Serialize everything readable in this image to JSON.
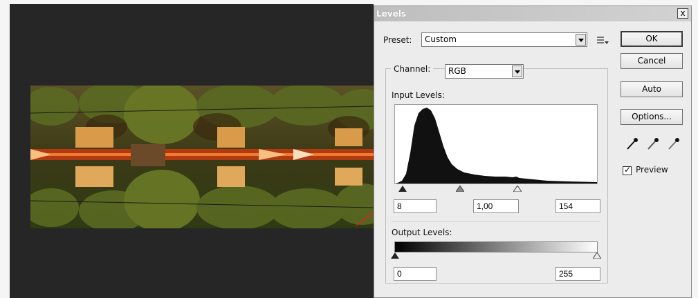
{
  "dialog": {
    "title": "Levels",
    "close": "x"
  },
  "preset": {
    "label": "Preset:",
    "value": "Custom"
  },
  "channel": {
    "label": "Channel:",
    "value": "RGB"
  },
  "input_levels": {
    "label": "Input Levels:",
    "black": "8",
    "gamma": "1,00",
    "white": "154"
  },
  "output_levels": {
    "label": "Output Levels:",
    "black": "0",
    "white": "255"
  },
  "buttons": {
    "ok": "OK",
    "cancel": "Cancel",
    "auto": "Auto",
    "options": "Options..."
  },
  "preview": {
    "label": "Preview",
    "checked": true
  },
  "icons": [
    "preset-menu-icon",
    "black-eyedropper-icon",
    "gray-eyedropper-icon",
    "white-eyedropper-icon"
  ],
  "colors": {
    "accent_arrow": "#e02020",
    "canvas_bg": "#262626"
  }
}
